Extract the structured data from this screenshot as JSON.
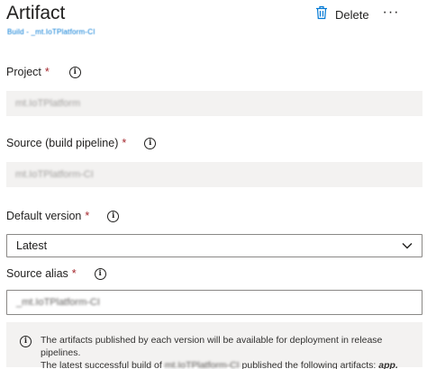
{
  "panel": {
    "title": "Artifact",
    "subtitle": "Build - _mt.IoTPlatform-CI",
    "delete_label": "Delete",
    "more_label": "···"
  },
  "fields": {
    "project": {
      "label": "Project",
      "required_mark": "*",
      "value": "mt.IoTPlatform"
    },
    "source": {
      "label": "Source (build pipeline)",
      "required_mark": "*",
      "value": "mt.IoTPlatform-CI"
    },
    "default_version": {
      "label": "Default version",
      "required_mark": "*",
      "value": "Latest"
    },
    "source_alias": {
      "label": "Source alias",
      "required_mark": "*",
      "value": "_mt.IoTPlatform-CI"
    }
  },
  "info": {
    "line1": "The artifacts published by each version will be available for deployment in release pipelines.",
    "line2_prefix": "The latest successful build of",
    "line2_name": "mt.IoTPlatform-CI",
    "line2_suffix": "published the following artifacts:",
    "artifact_name": "app."
  },
  "icons": {
    "delete": "trash-icon",
    "info": "info-icon",
    "chevron": "chevron-down-icon"
  },
  "colors": {
    "accent": "#0078d4",
    "required": "#a4262c",
    "disabled_bg": "#f3f2f1",
    "border": "#8a8886"
  }
}
